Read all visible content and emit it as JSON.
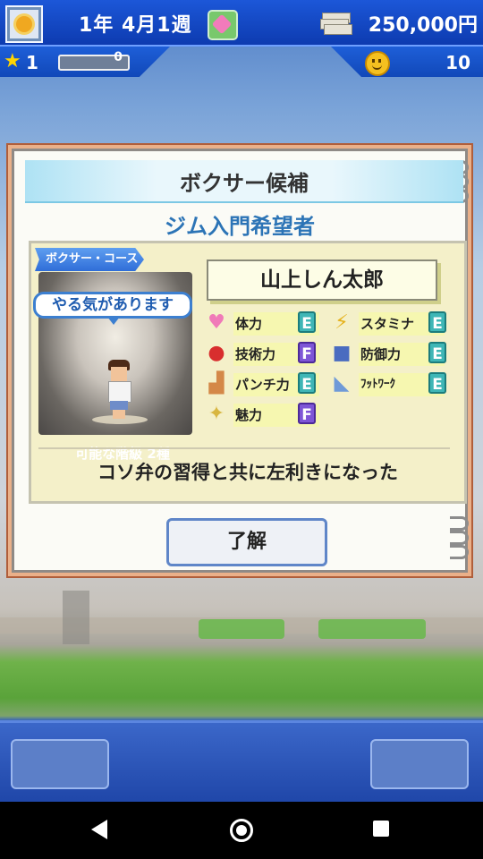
{
  "header": {
    "date": "1年 4月1週",
    "money": "250,000円",
    "stars": "1",
    "xp": "0",
    "fans": "10",
    "calendar_icon": "calendar-icon",
    "gem_icon": "gem-icon",
    "money_icon": "cash-stack-icon"
  },
  "dialog": {
    "title": "ボクサー候補",
    "subtitle": "ジム入門希望者",
    "course_tag": "ボクサー・コース",
    "speech": "やる気があります",
    "ranks_label": "可能な階級 2種",
    "name": "山上しん太郎",
    "stats": [
      {
        "label": "体力",
        "grade": "E",
        "icon": "heart-icon"
      },
      {
        "label": "スタミナ",
        "grade": "E",
        "icon": "lightning-icon"
      },
      {
        "label": "技術力",
        "grade": "F",
        "icon": "boxing-glove-icon"
      },
      {
        "label": "防御力",
        "grade": "E",
        "icon": "shirt-icon"
      },
      {
        "label": "パンチ力",
        "grade": "E",
        "icon": "arm-icon"
      },
      {
        "label": "ﾌｯﾄﾜｰｸ",
        "grade": "E",
        "icon": "shoe-icon"
      },
      {
        "label": "魅力",
        "grade": "F",
        "icon": "sparkle-icon"
      }
    ],
    "description": "コソ弁の習得と共に左利きになった",
    "ok_label": "了解"
  },
  "colors": {
    "grade_E": "#3fb6b6",
    "grade_F": "#7e56d6",
    "topbar": "#1c57d8",
    "accent_text": "#2c74b6"
  }
}
